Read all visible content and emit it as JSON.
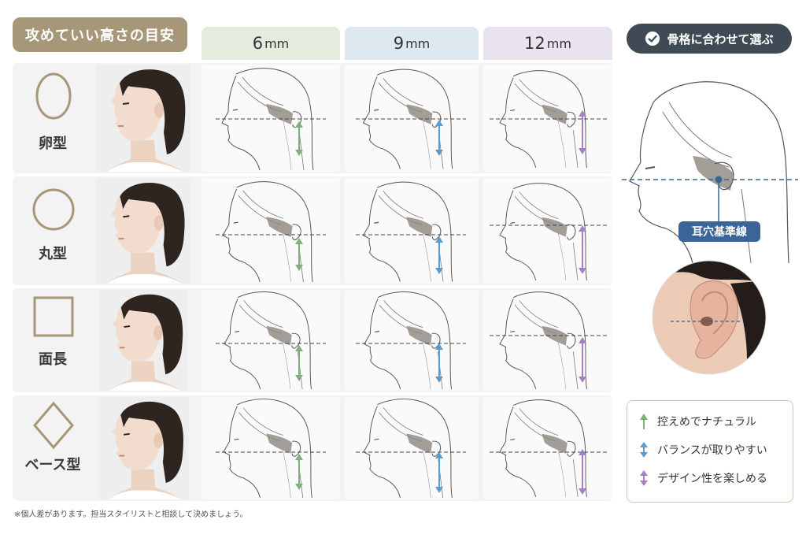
{
  "header": {
    "title": "攻めていい高さの目安"
  },
  "columns": [
    {
      "value": "6",
      "unit": "mm",
      "color": "#e4ecdf"
    },
    {
      "value": "9",
      "unit": "mm",
      "color": "#dde9ee"
    },
    {
      "value": "12",
      "unit": "mm",
      "color": "#e8e3ee"
    }
  ],
  "rows": [
    {
      "label": "卵型",
      "shape": "oval"
    },
    {
      "label": "丸型",
      "shape": "circle"
    },
    {
      "label": "面長",
      "shape": "square"
    },
    {
      "label": "ベース型",
      "shape": "diamond"
    }
  ],
  "side_panel": {
    "badge_label": "骨格に合わせて選ぶ",
    "ear_line_label": "耳穴基準線"
  },
  "legend": [
    {
      "label": "控えめでナチュラル",
      "color": "#7fb07a"
    },
    {
      "label": "バランスが取りやすい",
      "color": "#5c9ccc"
    },
    {
      "label": "デザイン性を楽しめる",
      "color": "#a680c4"
    }
  ],
  "footnote": "※個人差があります。担当スタイリストと相談して決めましょう。",
  "colors": {
    "accent_brown": "#a69779",
    "badge_dark": "#3f4a54",
    "ear_line_blue": "#3a6597"
  }
}
